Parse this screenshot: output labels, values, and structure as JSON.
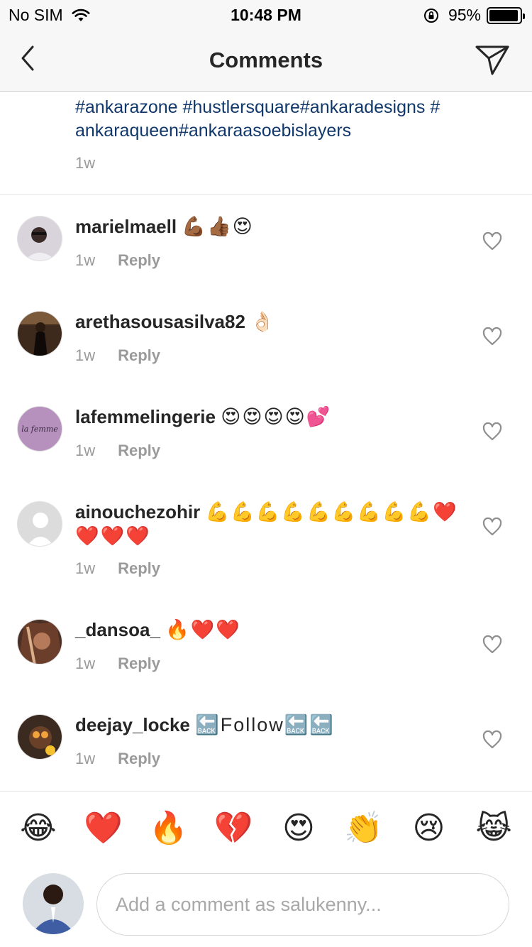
{
  "status_bar": {
    "carrier": "No SIM",
    "time": "10:48 PM",
    "battery_percent": "95%",
    "battery_level": 0.95,
    "icons": [
      "wifi-icon",
      "orientation-lock-icon",
      "battery-icon"
    ]
  },
  "nav": {
    "title": "Comments",
    "icons": [
      "back-chevron-icon",
      "send-direct-icon"
    ]
  },
  "caption": {
    "text": "#ankarazone #hustlersquare#ankaradesigns # ankaraqueen#ankaraasoebislayers",
    "time": "1w"
  },
  "comments": [
    {
      "username": "marielmaell",
      "body": "💪🏾👍🏾😍",
      "time": "1w",
      "reply": "Reply"
    },
    {
      "username": "arethasousasilva82",
      "body": "👌🏻",
      "time": "1w",
      "reply": "Reply"
    },
    {
      "username": "lafemmelingerie",
      "body": "😍😍😍😍💕",
      "time": "1w",
      "reply": "Reply",
      "avatar_text": "la femme"
    },
    {
      "username": "ainouchezohir",
      "body": "💪💪💪💪💪💪💪💪💪❤️❤️❤️❤️",
      "time": "1w",
      "reply": "Reply"
    },
    {
      "username": "_dansoa_",
      "body": "🔥❤️❤️",
      "time": "1w",
      "reply": "Reply"
    },
    {
      "username": "deejay_locke",
      "body": "🔙Follow🔙🔙",
      "time": "1w",
      "reply": "Reply"
    }
  ],
  "quick_emojis": [
    "😂",
    "❤️",
    "🔥",
    "💔",
    "😍",
    "👏",
    "😢",
    "😹"
  ],
  "comment_box": {
    "placeholder": "Add a comment as salukenny..."
  },
  "colors": {
    "hashtag": "#11386b",
    "secondary_text": "#9a9a9a",
    "nav_background": "#f7f7f7"
  }
}
